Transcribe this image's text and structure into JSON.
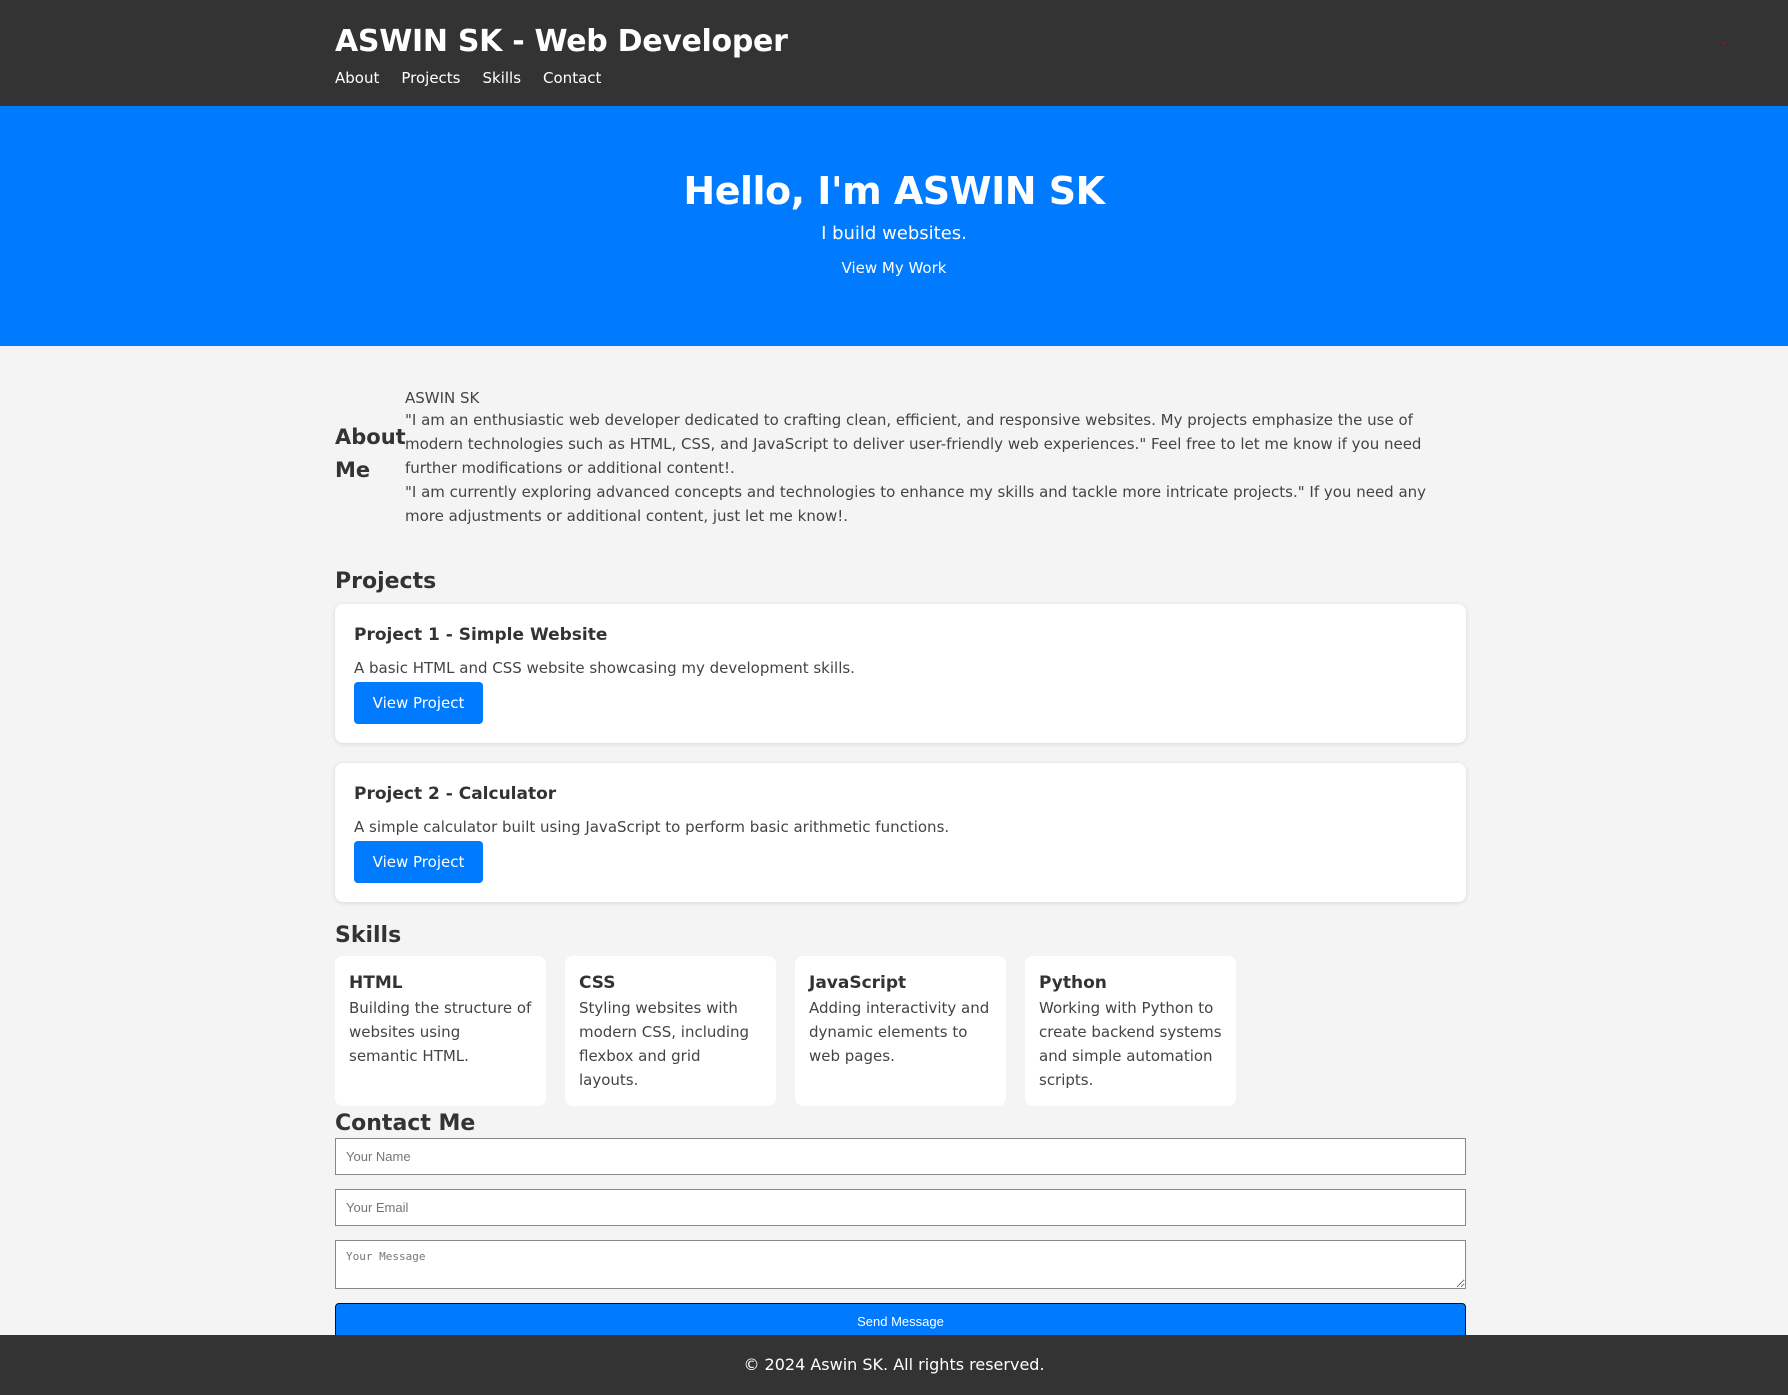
{
  "header": {
    "title": "ASWIN SK - Web Developer",
    "nav": [
      "About",
      "Projects",
      "Skills",
      "Contact"
    ]
  },
  "hero": {
    "heading": "Hello, I'm ASWIN SK",
    "subtitle": "I build websites.",
    "cta": "View My Work"
  },
  "about": {
    "title": "About Me",
    "image_alt": "ASWIN SK",
    "paragraph1": "\"I am an enthusiastic web developer dedicated to crafting clean, efficient, and responsive websites. My projects emphasize the use of modern technologies such as HTML, CSS, and JavaScript to deliver user-friendly web experiences.\" Feel free to let me know if you need further modifications or additional content!.",
    "paragraph2": "\"I am currently exploring advanced concepts and technologies to enhance my skills and tackle more intricate projects.\" If you need any more adjustments or additional content, just let me know!."
  },
  "projects": {
    "title": "Projects",
    "items": [
      {
        "title": "Project 1 - Simple Website",
        "description": "A basic HTML and CSS website showcasing my development skills.",
        "button": "View Project"
      },
      {
        "title": "Project 2 - Calculator",
        "description": "A simple calculator built using JavaScript to perform basic arithmetic functions.",
        "button": "View Project"
      }
    ]
  },
  "skills": {
    "title": "Skills",
    "items": [
      {
        "name": "HTML",
        "description": "Building the structure of websites using semantic HTML."
      },
      {
        "name": "CSS",
        "description": "Styling websites with modern CSS, including flexbox and grid layouts."
      },
      {
        "name": "JavaScript",
        "description": "Adding interactivity and dynamic elements to web pages."
      },
      {
        "name": "Python",
        "description": "Working with Python to create backend systems and simple automation scripts."
      }
    ]
  },
  "contact": {
    "title": "Contact Me",
    "name_placeholder": "Your Name",
    "email_placeholder": "Your Email",
    "message_placeholder": "Your Message",
    "submit": "Send Message"
  },
  "footer": {
    "text": "© 2024 Aswin SK. All rights reserved."
  },
  "colors": {
    "header_bg": "#333333",
    "accent": "#007bff",
    "page_bg": "#f4f4f4"
  }
}
